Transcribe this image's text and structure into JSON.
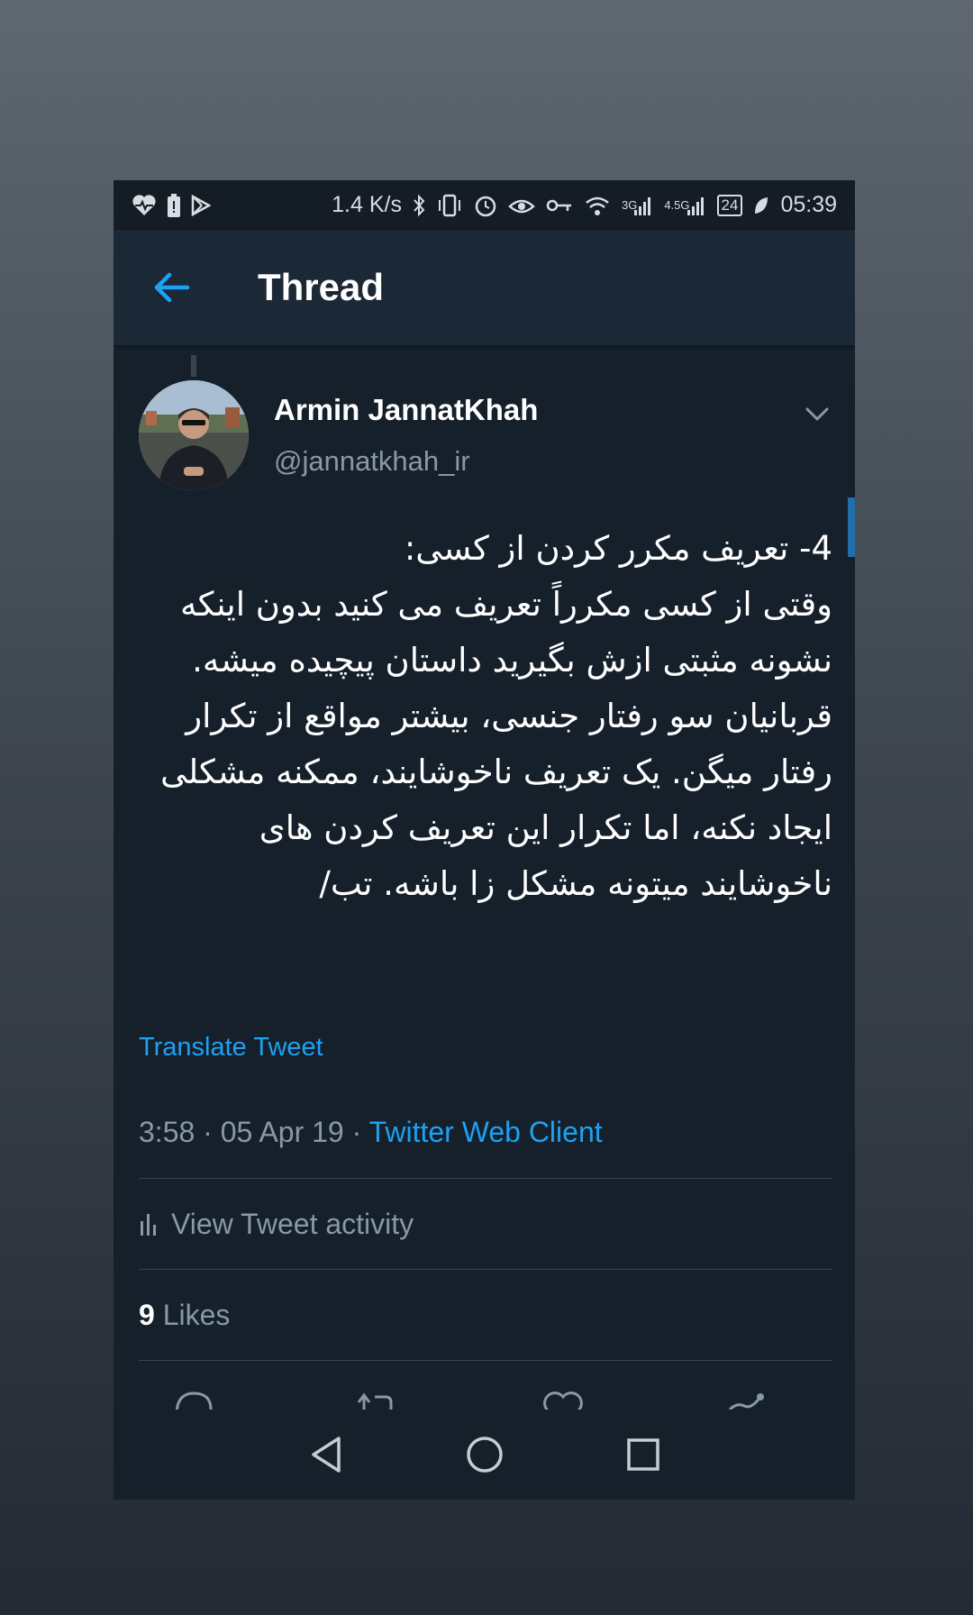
{
  "status_bar": {
    "speed": "1.4 K/s",
    "net_3g": "3G",
    "net_4g": "4.5G",
    "battery": "24",
    "time": "05:39"
  },
  "app_bar": {
    "title": "Thread"
  },
  "tweet": {
    "author_name": "Armin JannatKhah",
    "author_handle": "@jannatkhah_ir",
    "text": "4- تعریف مکرر کردن از کسی:\nوقتی از کسی مکرراً تعریف می کنید بدون اینکه نشونه مثبتی ازش بگیرید داستان پیچیده میشه. قربانیان سو رفتار جنسی، بیشتر مواقع از تکرار رفتار میگن. یک تعریف ناخوشایند، ممکنه مشکلی ایجاد نکنه، اما تکرار این تعریف کردن های ناخوشایند میتونه مشکل زا باشه. تب/",
    "translate_label": "Translate Tweet",
    "time": "3:58",
    "date": "05 Apr 19",
    "separator": "·",
    "client": "Twitter Web Client",
    "activity_label": "View Tweet activity",
    "likes_count": "9",
    "likes_label": "Likes"
  },
  "colors": {
    "background": "#15202b",
    "app_bar": "#1b2836",
    "accent": "#1da1f2",
    "secondary_text": "#8899a6",
    "divider": "#38444d"
  },
  "icons": {
    "back": "arrow-left-icon",
    "menu": "chevron-down-icon",
    "activity": "bar-chart-icon",
    "reply": "reply-icon",
    "retweet": "retweet-icon",
    "like": "heart-icon",
    "share": "share-icon",
    "nav_back": "triangle-back-icon",
    "nav_home": "circle-home-icon",
    "nav_recents": "square-recents-icon"
  }
}
